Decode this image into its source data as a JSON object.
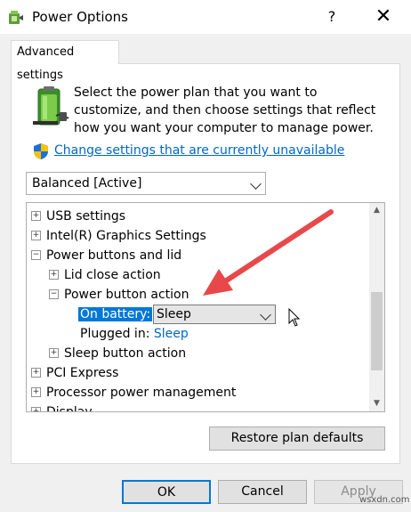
{
  "window": {
    "title": "Power Options"
  },
  "titlebar": {
    "help": "?",
    "close": "✕"
  },
  "tab": {
    "label": "Advanced settings"
  },
  "description": "Select the power plan that you want to customize, and then choose settings that reflect how you want your computer to manage power.",
  "change_link": "Change settings that are currently unavailable",
  "plan": {
    "selected": "Balanced [Active]"
  },
  "tree": {
    "usb": "USB settings",
    "intel": "Intel(R) Graphics Settings",
    "power_buttons": "Power buttons and lid",
    "lid_close": "Lid close action",
    "power_button": "Power button action",
    "on_battery_label": "On battery:",
    "on_battery_value": "Sleep",
    "plugged_in_label": "Plugged in:",
    "plugged_in_value": "Sleep",
    "sleep_button": "Sleep button action",
    "pci": "PCI Express",
    "processor": "Processor power management",
    "display": "Display"
  },
  "expanders": {
    "plus": "+",
    "minus": "−"
  },
  "buttons": {
    "restore": "Restore plan defaults",
    "ok": "OK",
    "cancel": "Cancel",
    "apply": "Apply"
  },
  "watermark": "wsxdn.com",
  "colors": {
    "accent": "#0078d7",
    "link": "#0066cc",
    "arrow": "#e8484a"
  }
}
